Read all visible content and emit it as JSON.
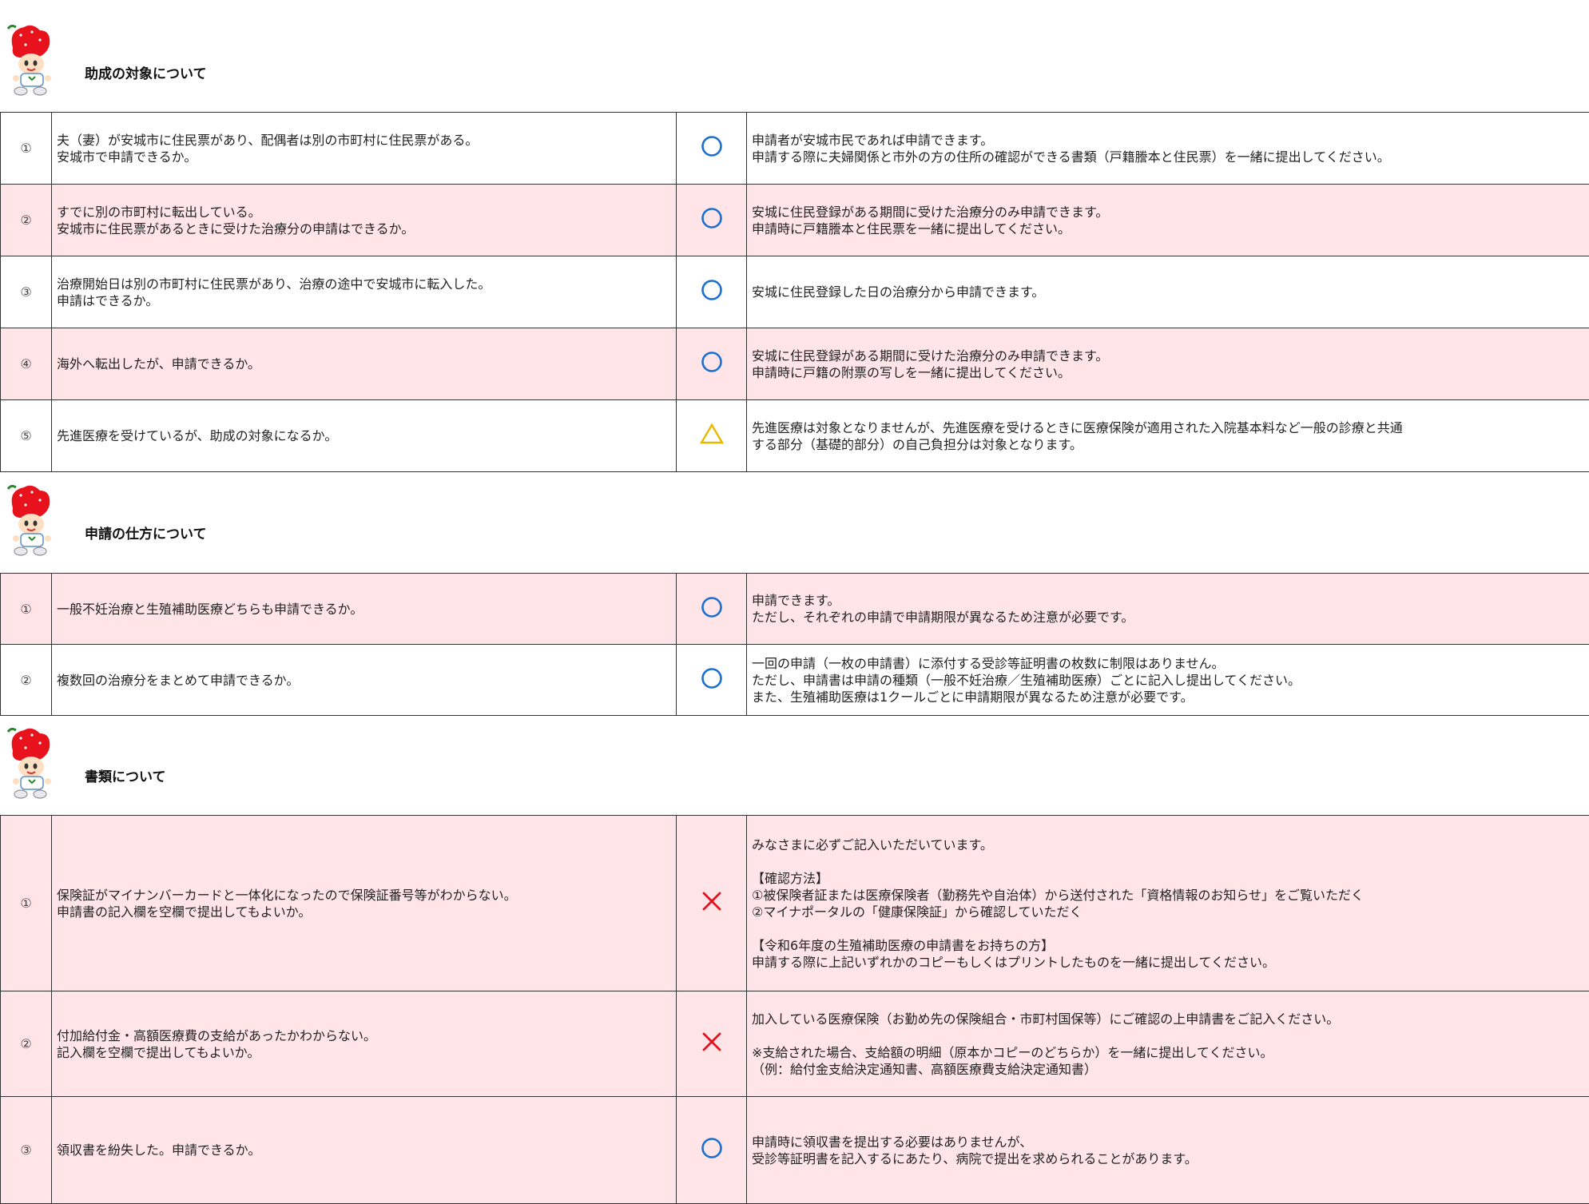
{
  "colors": {
    "pink_row": "#ffe4e8",
    "circle_mark": "#1a6fd0",
    "triangle_mark": "#e8b800",
    "cross_mark": "#e0141e",
    "mascot_red": "#e8121c"
  },
  "sections": [
    {
      "title": "助成の対象について",
      "icon": "strawberry-mascot-icon",
      "rows": [
        {
          "num": "①",
          "question": "夫（妻）が安城市に住民票があり、配偶者は別の市町村に住民票がある。\n安城市で申請できるか。",
          "mark": "circle",
          "answer": "申請者が安城市民であれば申請できます。\n申請する際に夫婦関係と市外の方の住所の確認ができる書類（戸籍謄本と住民票）を一緒に提出してください。"
        },
        {
          "num": "②",
          "question": "すでに別の市町村に転出している。\n安城市に住民票があるときに受けた治療分の申請はできるか。",
          "mark": "circle",
          "answer": "安城に住民登録がある期間に受けた治療分のみ申請できます。\n申請時に戸籍謄本と住民票を一緒に提出してください。"
        },
        {
          "num": "③",
          "question": "治療開始日は別の市町村に住民票があり、治療の途中で安城市に転入した。\n申請はできるか。",
          "mark": "circle",
          "answer": "安城に住民登録した日の治療分から申請できます。"
        },
        {
          "num": "④",
          "question": "海外へ転出したが、申請できるか。",
          "mark": "circle",
          "answer": "安城に住民登録がある期間に受けた治療分のみ申請できます。\n申請時に戸籍の附票の写しを一緒に提出してください。"
        },
        {
          "num": "⑤",
          "question": "先進医療を受けているが、助成の対象になるか。",
          "mark": "triangle",
          "answer": "先進医療は対象となりませんが、先進医療を受けるときに医療保険が適用された入院基本料など一般の診療と共通\nする部分（基礎的部分）の自己負担分は対象となります。"
        }
      ]
    },
    {
      "title": "申請の仕方について",
      "icon": "strawberry-mascot-icon",
      "rows": [
        {
          "num": "①",
          "question": "一般不妊治療と生殖補助医療どちらも申請できるか。",
          "mark": "circle",
          "answer": "申請できます。\nただし、それぞれの申請で申請期限が異なるため注意が必要です。"
        },
        {
          "num": "②",
          "question": "複数回の治療分をまとめて申請できるか。",
          "mark": "circle",
          "answer": "一回の申請（一枚の申請書）に添付する受診等証明書の枚数に制限はありません。\nただし、申請書は申請の種類（一般不妊治療／生殖補助医療）ごとに記入し提出してください。\nまた、生殖補助医療は1クールごとに申請期限が異なるため注意が必要です。"
        }
      ]
    },
    {
      "title": "書類について",
      "icon": "strawberry-mascot-icon",
      "rows": [
        {
          "num": "①",
          "question": "保険証がマイナンバーカードと一体化になったので保険証番号等がわからない。\n申請書の記入欄を空欄で提出してもよいか。",
          "mark": "cross",
          "answer": "みなさまに必ずご記入いただいています。\n\n【確認方法】\n①被保険者証または医療保険者（勤務先や自治体）から送付された「資格情報のお知らせ」をご覧いただく\n②マイナポータルの「健康保険証」から確認していただく\n\n【令和6年度の生殖補助医療の申請書をお持ちの方】\n申請する際に上記いずれかのコピーもしくはプリントしたものを一緒に提出してください。"
        },
        {
          "num": "②",
          "question": "付加給付金・高額医療費の支給があったかわからない。\n記入欄を空欄で提出してもよいか。",
          "mark": "cross",
          "answer": "加入している医療保険（お勤め先の保険組合・市町村国保等）にご確認の上申請書をご記入ください。\n\n※支給された場合、支給額の明細（原本かコピーのどちらか）を一緒に提出してください。\n（例：給付金支給決定通知書、高額医療費支給決定通知書）"
        },
        {
          "num": "③",
          "question": "領収書を紛失した。申請できるか。",
          "mark": "circle",
          "answer": "申請時に領収書を提出する必要はありませんが、\n受診等証明書を記入するにあたり、病院で提出を求められることがあります。"
        }
      ]
    }
  ]
}
